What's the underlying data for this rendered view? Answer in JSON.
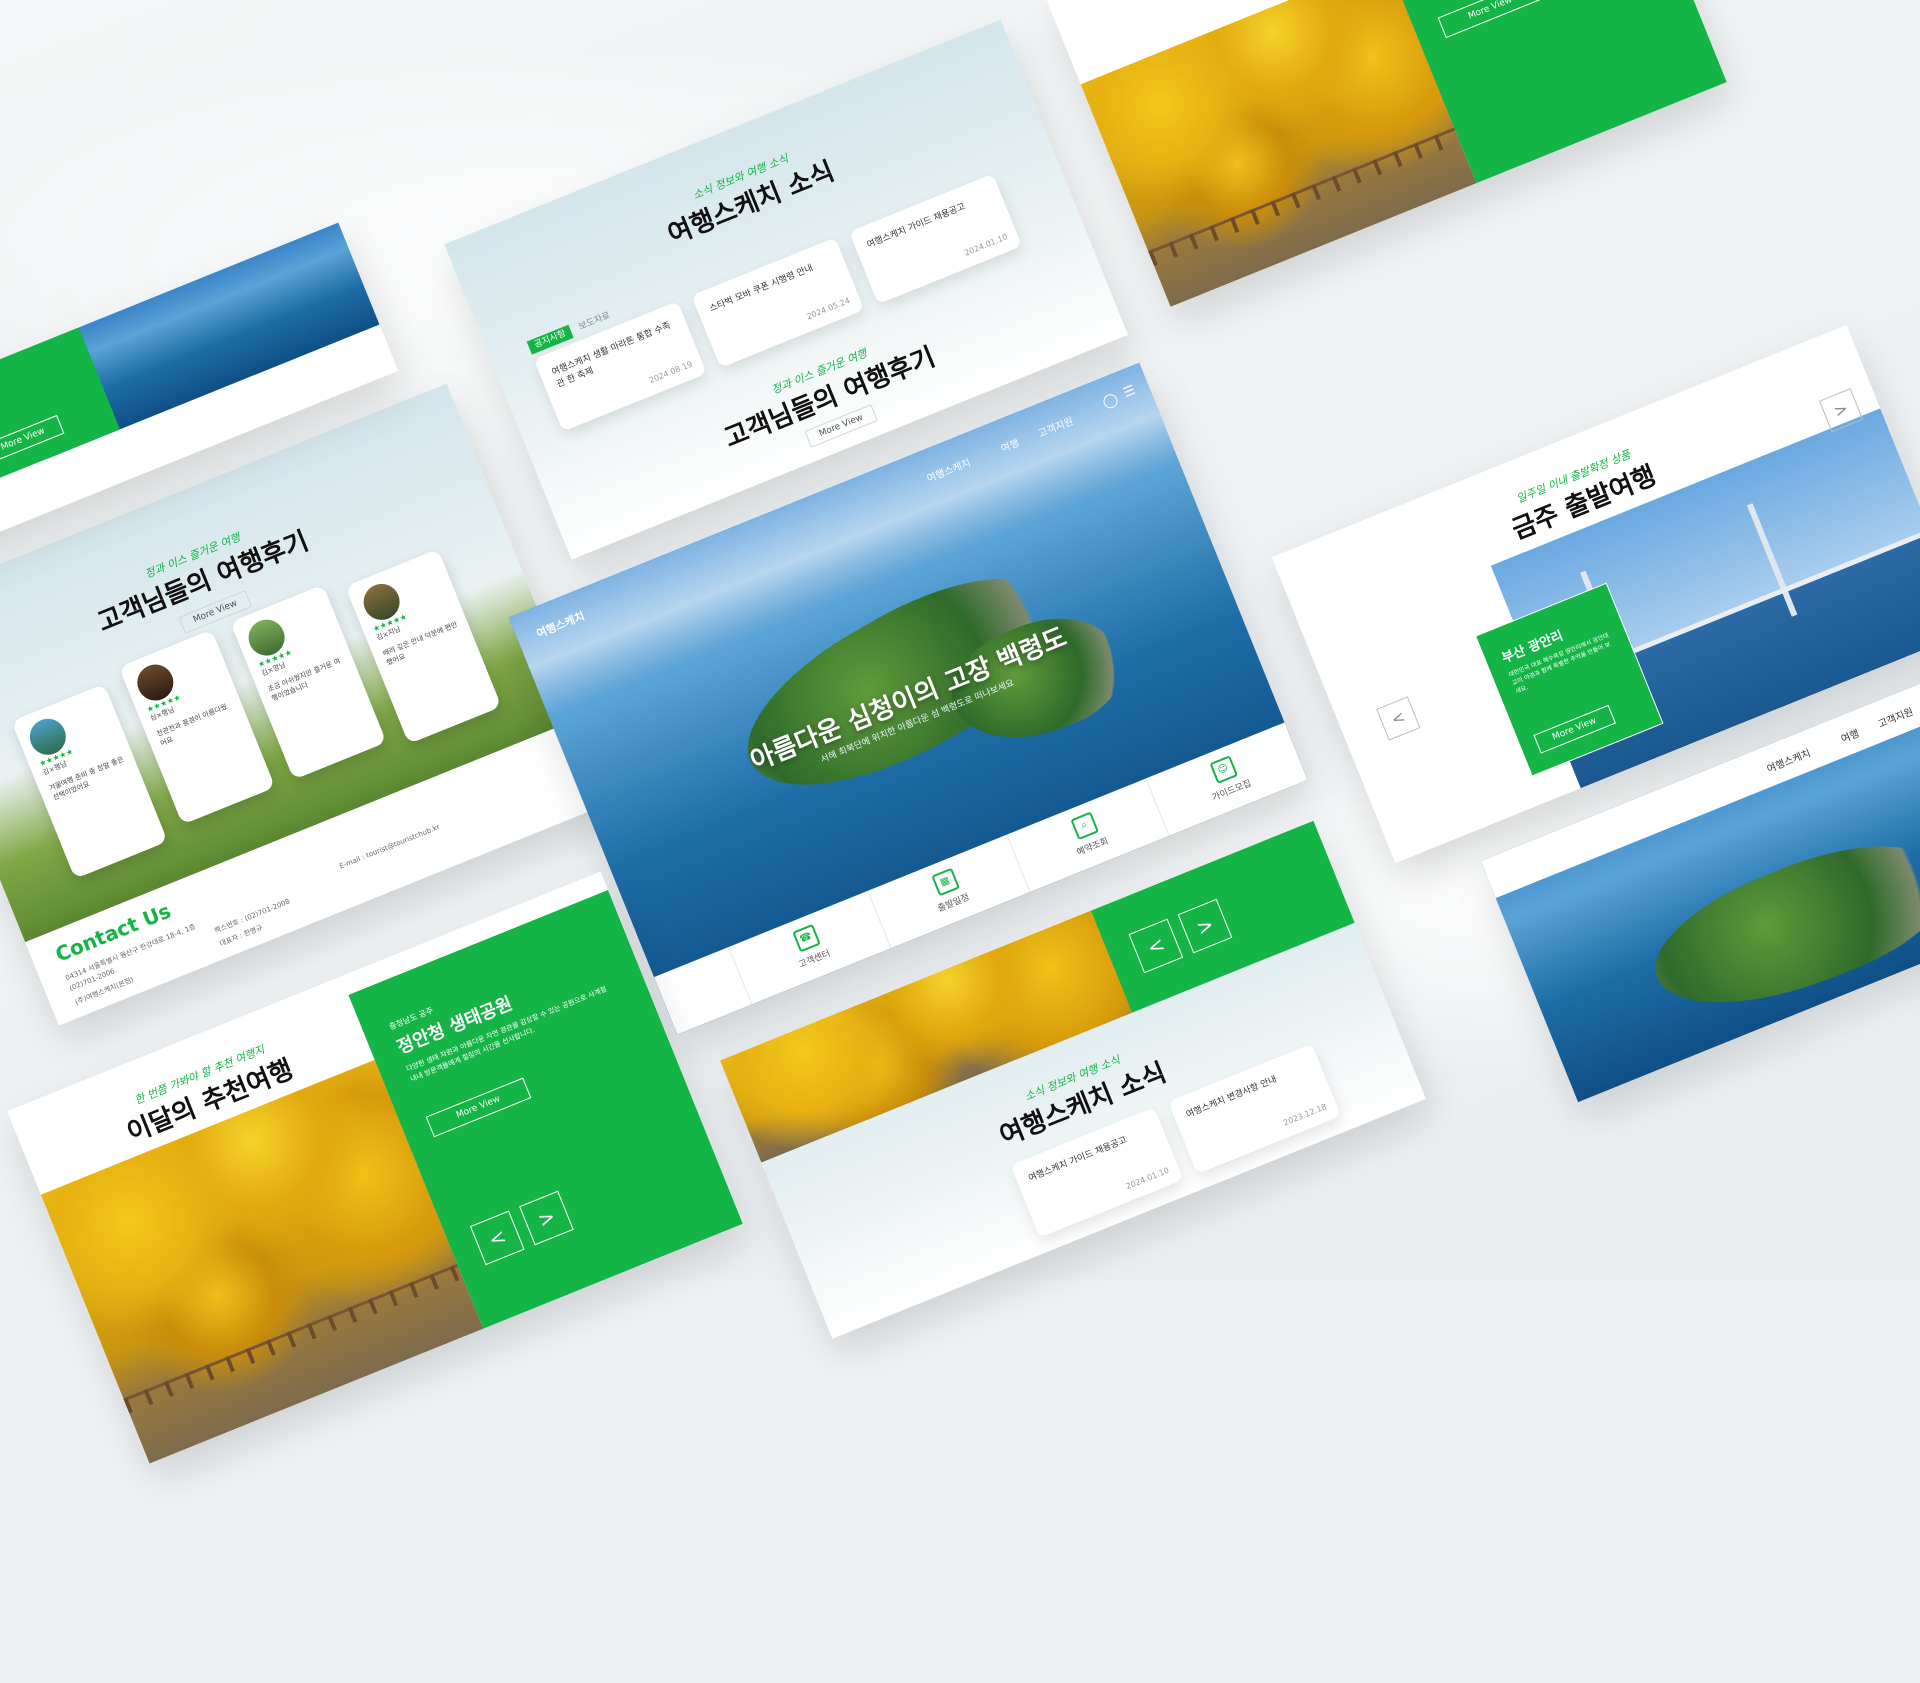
{
  "reviews": {
    "sub": "정과 이스 즐거운 여행",
    "title": "고객님들의 여행후기",
    "more": "More View",
    "items": [
      {
        "name": "김×행님",
        "stars": "★★★★★",
        "text": "겨울여행 준비 중 정말 좋은 선택이었어요"
      },
      {
        "name": "심×행님",
        "stars": "★★★★★",
        "text": "천관전과 풍경이 아름다웠어요"
      },
      {
        "name": "김×영님",
        "stars": "★★★★★",
        "text": "조금 아쉬웠지만 즐거운 여행이었습니다"
      },
      {
        "name": "김×지님",
        "stars": "★★★★★",
        "text": "배려 깊은 안내 덕분에 편안했어요"
      }
    ]
  },
  "contact": {
    "title": "Contact Us",
    "address": "04314 서울특별시 용산구 한강대로 18-4, 1층",
    "tel": "(02)701-2006",
    "fax": "팩스번호 : (02)701-2008",
    "email": "E-mail : tourist@touristchub.kr",
    "company": "(주)여행스케치(본점)",
    "rep": "대표자 : 한명규"
  },
  "news": {
    "sub": "소식 정보와 여행 소식",
    "title": "여행스케치 소식",
    "tab_notice": "공지사항",
    "tab_press": "보도자료",
    "items": [
      {
        "title": "여행스케치 가이드 채용공고",
        "date": "2024.01.10"
      },
      {
        "title": "여행스케치 변경사항 안내",
        "date": "2023.12.18"
      },
      {
        "title": "스타벅 모바 쿠폰 시행령 안내",
        "date": "2024.05.24"
      },
      {
        "title": "여행스케치 생활 마라톤 통합 수족관 한 축제",
        "date": "2024.08.19"
      }
    ]
  },
  "monthly": {
    "sub": "한 번쯤 가봐야 할 추천 여행지",
    "title": "이달의 추천여행",
    "region": "충청남도 공주",
    "place": "정안청 생태공원",
    "desc": "다양한 생태 자원과 아름다운 자연 경관을 감상할 수 있는 공원으로 사계절 내내 방문객들에게 힐링의 시간을 선사합니다.",
    "more": "More View",
    "prev": "<",
    "next": ">"
  },
  "hero": {
    "logo": "여행스케치",
    "nav_domestic": "여행",
    "nav_customer": "고객지원",
    "nav_tour": "여행스케치",
    "headline": "아름다운 심청이의 고장 백령도",
    "subhead": "서해 최북단에 위치한 아름다운 섬 백령도로 떠나보세요",
    "tabs": [
      "고객센터",
      "출발일정",
      "예약조회",
      "가이드모집"
    ]
  },
  "departure": {
    "sub": "일주일 이내 출발확정 상품",
    "title": "금주 출발여행",
    "place": "부산 광안리",
    "desc": "대한민국 대표 해수욕장 광안리에서 광안대교의 야경과 함께 특별한 추억을 만들어 보세요.",
    "more": "More View",
    "prev": "<",
    "next": ">"
  },
  "colors": {
    "brand_green": "#14b447",
    "white": "#ffffff"
  }
}
